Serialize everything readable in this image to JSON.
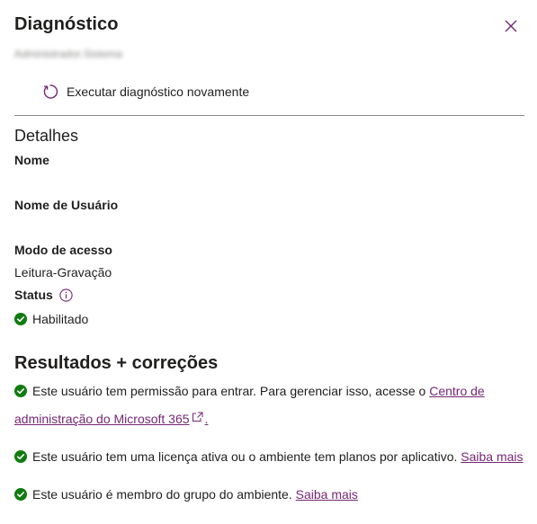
{
  "panel": {
    "title": "Diagnóstico",
    "subtitle": "Administrador.Sistema",
    "rerun_label": "Executar diagnóstico novamente"
  },
  "details": {
    "heading": "Detalhes",
    "name_label": "Nome",
    "username_label": "Nome de Usuário",
    "access_mode_label": "Modo de acesso",
    "access_mode_value": "Leitura-Gravação",
    "status_label": "Status",
    "status_value": "Habilitado"
  },
  "results": {
    "heading": "Resultados + correções",
    "items": [
      {
        "text_line1": "Este usuário tem permissão para entrar. Para gerenciar isso, acesse o ",
        "link_line1": "Centro de",
        "link_line2": "administração do Microsoft 365",
        "suffix": "."
      },
      {
        "text": "Este usuário tem uma licença ativa ou o ambiente tem planos por aplicativo. ",
        "link": "Saiba mais"
      },
      {
        "text": "Este usuário é membro do grupo do ambiente. ",
        "link": "Saiba mais"
      }
    ]
  },
  "colors": {
    "accent": "#742774",
    "success": "#107c10",
    "divider": "#8a8886",
    "text": "#201f1e"
  },
  "icons": {
    "close": "close-icon",
    "rerun": "refresh-icon",
    "info": "info-icon",
    "success": "checkmark-circle-icon",
    "external": "external-link-icon"
  }
}
